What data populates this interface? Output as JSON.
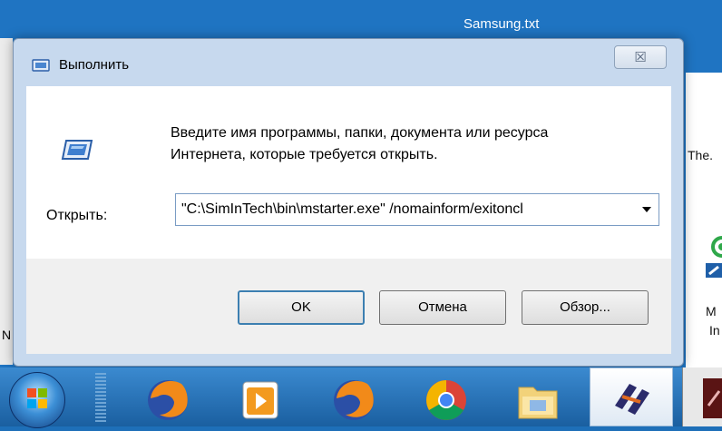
{
  "desktop": {
    "title": "Samsung.txt",
    "frag_the": "The.",
    "frag_m": "M",
    "frag_in": "In",
    "frag_n": "N"
  },
  "dialog": {
    "title": "Выполнить",
    "close_label": "☒",
    "description_line1": "Введите имя программы, папки, документа или ресурса",
    "description_line2": "Интернета, которые требуется открыть.",
    "open_label": "Открыть:",
    "open_value": "\"C:\\SimInTech\\bin\\mstarter.exe\" /nomainform/exitoncl",
    "ok_label": "OK",
    "cancel_label": "Отмена",
    "browse_label": "Обзор..."
  },
  "taskbar": {
    "icons": [
      "start-orb-icon",
      "firefox-icon",
      "media-player-icon",
      "firefox-icon",
      "chrome-icon",
      "folder-icon",
      "siminth-icon",
      "app-icon"
    ]
  },
  "colors": {
    "desktop": "#1f74c2",
    "dialog_frame": "#c7d9ee",
    "default_button_border": "#3c7fb1",
    "taskbar": "#2a75bd"
  }
}
